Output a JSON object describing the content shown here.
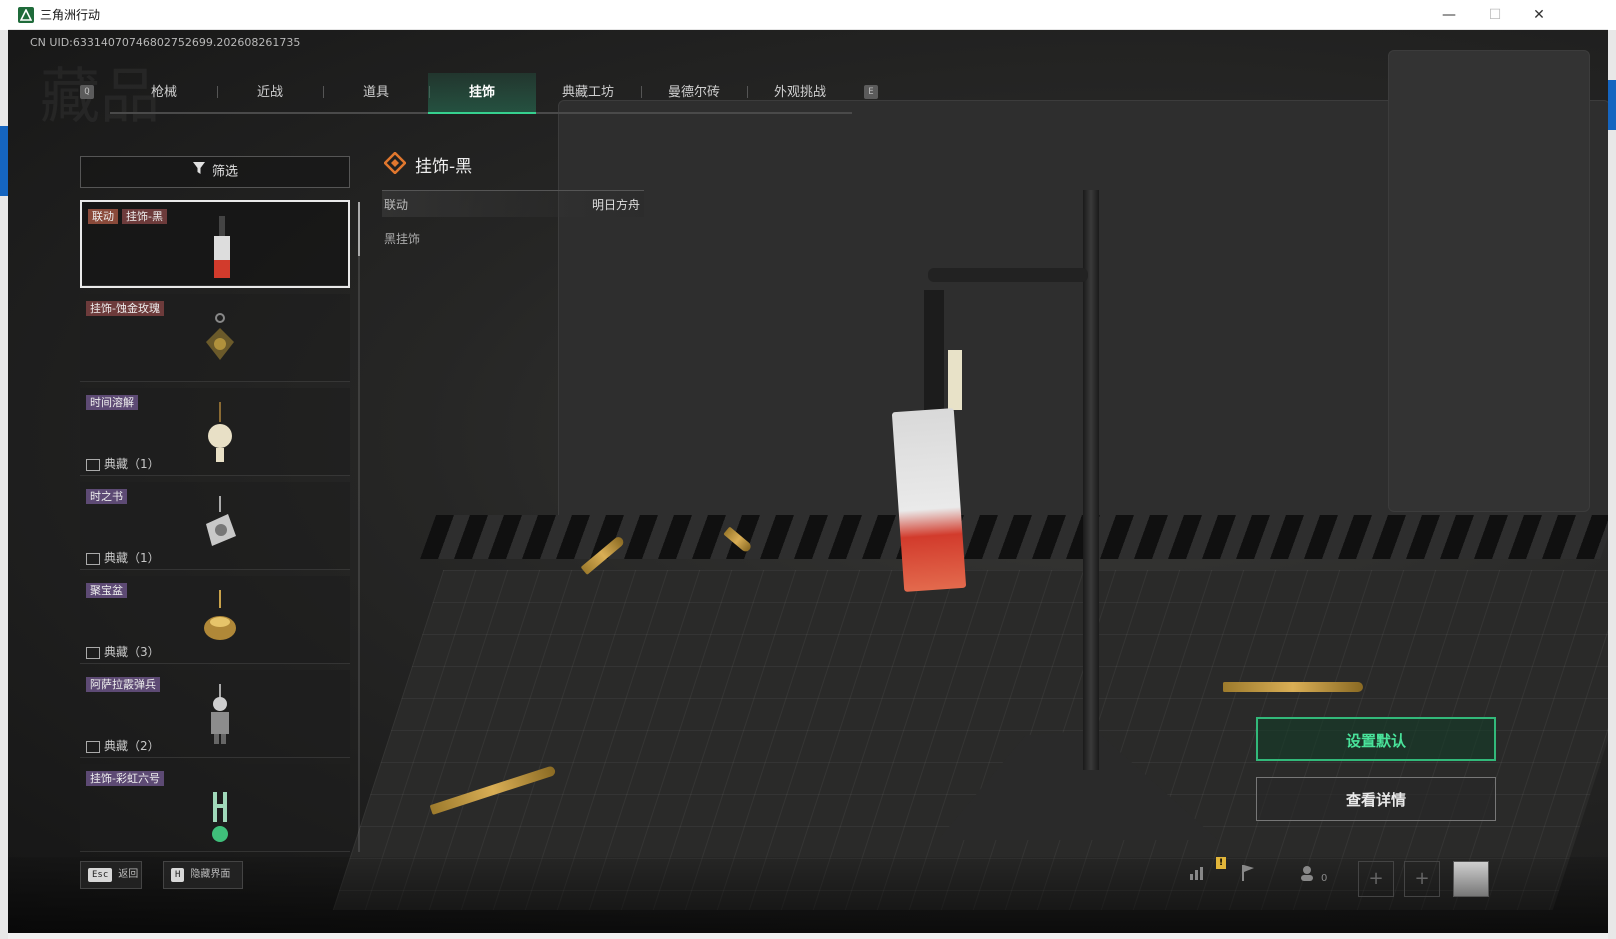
{
  "window": {
    "title": "三角洲行动",
    "minimize": "—",
    "maximize": "☐",
    "close": "✕"
  },
  "uid": "CN UID:633140707468027526​99.202608261735",
  "background_glyph": "藏品",
  "tabs": {
    "left_key": "Q",
    "right_key": "E",
    "items": [
      {
        "label": "枪械",
        "active": false
      },
      {
        "label": "近战",
        "active": false
      },
      {
        "label": "道具",
        "active": false
      },
      {
        "label": "挂饰",
        "active": true
      },
      {
        "label": "典藏工坊",
        "active": false
      },
      {
        "label": "曼德尔砖",
        "active": false
      },
      {
        "label": "外观挑战",
        "active": false
      }
    ]
  },
  "filter": {
    "label": "筛选",
    "icon": "filter-icon"
  },
  "items": [
    {
      "tag": "联动",
      "name": "挂饰-黑",
      "collect": "",
      "selected": true
    },
    {
      "tag": "",
      "name": "挂饰-蚀金玫瑰",
      "collect": "",
      "selected": false
    },
    {
      "tag": "",
      "name": "时间溶解",
      "collect": "典藏（1）",
      "selected": false
    },
    {
      "tag": "",
      "name": "时之书",
      "collect": "典藏（1）",
      "selected": false
    },
    {
      "tag": "",
      "name": "聚宝盆",
      "collect": "典藏（3）",
      "selected": false
    },
    {
      "tag": "",
      "name": "阿萨拉霰弹兵",
      "collect": "典藏（2）",
      "selected": false
    },
    {
      "tag": "",
      "name": "挂饰-彩虹六号",
      "collect": "",
      "selected": false
    }
  ],
  "detail": {
    "title": "挂饰-黑",
    "row_key": "联动",
    "row_value": "明日方舟",
    "description": "黑挂饰"
  },
  "actions": {
    "set_default": "设置默认",
    "view_detail": "查看详情"
  },
  "bottom": {
    "esc_key": "Esc",
    "esc_label": "返回",
    "h_key": "H",
    "h_label": "隐藏界面",
    "friends_count": "0",
    "warn": "!"
  },
  "colors": {
    "accent_green": "#36d18f",
    "tag_brown": "#8a4a3a",
    "name_purple": "#5d4a74"
  }
}
